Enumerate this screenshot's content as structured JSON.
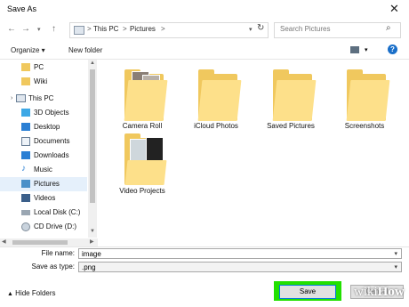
{
  "window": {
    "title": "Save As"
  },
  "address": {
    "crumbs": [
      "This PC",
      "Pictures"
    ]
  },
  "search": {
    "placeholder": "Search Pictures"
  },
  "toolbar": {
    "organize": "Organize ▾",
    "new_folder": "New folder"
  },
  "sidebar": {
    "items": [
      {
        "label": "PC",
        "icon": "folder-icon"
      },
      {
        "label": "Wiki",
        "icon": "folder-icon"
      },
      {
        "label": "This PC",
        "icon": "computer-icon"
      },
      {
        "label": "3D Objects",
        "icon": "cube-icon"
      },
      {
        "label": "Desktop",
        "icon": "desktop-icon"
      },
      {
        "label": "Documents",
        "icon": "documents-icon"
      },
      {
        "label": "Downloads",
        "icon": "download-icon"
      },
      {
        "label": "Music",
        "icon": "music-icon"
      },
      {
        "label": "Pictures",
        "icon": "pictures-icon"
      },
      {
        "label": "Videos",
        "icon": "videos-icon"
      },
      {
        "label": "Local Disk (C:)",
        "icon": "disk-icon"
      },
      {
        "label": "CD Drive (D:)",
        "icon": "cd-icon"
      }
    ]
  },
  "folders": [
    {
      "name": "Camera Roll"
    },
    {
      "name": "iCloud Photos"
    },
    {
      "name": "Saved Pictures"
    },
    {
      "name": "Screenshots"
    },
    {
      "name": "Video Projects"
    }
  ],
  "form": {
    "file_name_label": "File name:",
    "file_name_value": "image",
    "save_type_label": "Save as type:",
    "save_type_value": ".png"
  },
  "footer": {
    "hide_folders": "Hide Folders",
    "save": "Save",
    "cancel": "Cancel"
  },
  "watermark": {
    "wiki": "wiki",
    "how": "How"
  },
  "colors": {
    "highlight": "#22e000",
    "folder": "#f0c85e",
    "selection": "#e5f0fb"
  }
}
